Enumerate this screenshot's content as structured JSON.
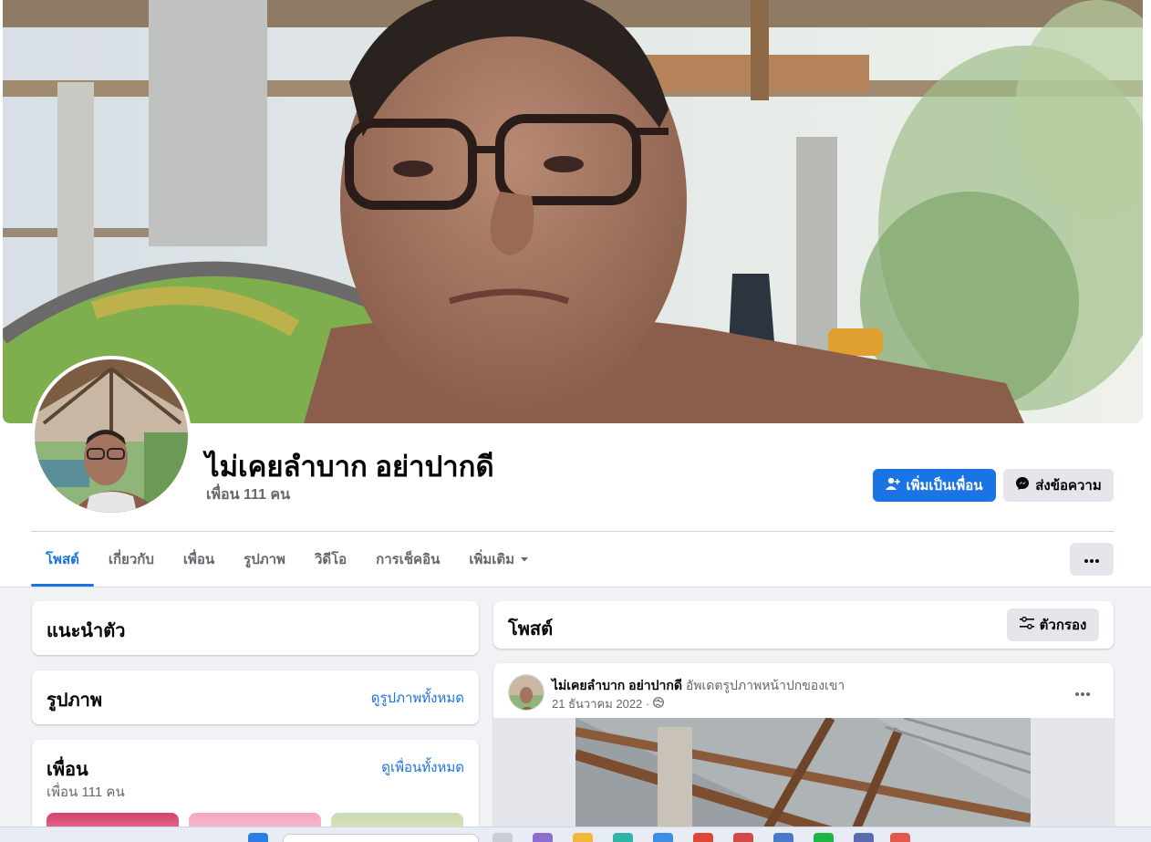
{
  "profile": {
    "name": "ไม่เคยลำบาก อย่าปากดี",
    "friend_count": "เพื่อน 111 คน"
  },
  "actions": {
    "add_friend": "เพิ่มเป็นเพื่อน",
    "message": "ส่งข้อความ"
  },
  "tabs": [
    {
      "label": "โพสต์",
      "active": true
    },
    {
      "label": "เกี่ยวกับ"
    },
    {
      "label": "เพื่อน"
    },
    {
      "label": "รูปภาพ"
    },
    {
      "label": "วิดีโอ"
    },
    {
      "label": "การเช็คอิน"
    },
    {
      "label": "เพิ่มเติม"
    }
  ],
  "intro": {
    "title": "แนะนำตัว"
  },
  "photos": {
    "title": "รูปภาพ",
    "see_all": "ดูรูปภาพทั้งหมด"
  },
  "friends": {
    "title": "เพื่อน",
    "see_all": "ดูเพื่อนทั้งหมด",
    "count": "เพื่อน 111 คน"
  },
  "posts": {
    "title": "โพสต์",
    "filter": "ตัวกรอง"
  },
  "post": {
    "author": "ไม่เคยลำบาก อย่าปากดี",
    "action": "อัพเดตรูปภาพหน้าปกของเขา",
    "date": "21 ธันวาคม 2022 ·",
    "privacy_icon": "globe-icon"
  },
  "colors": {
    "accent": "#1b74e4",
    "page_bg": "#f0f2f5",
    "button_gray": "#e4e6eb",
    "secondary_text": "#65676b"
  }
}
